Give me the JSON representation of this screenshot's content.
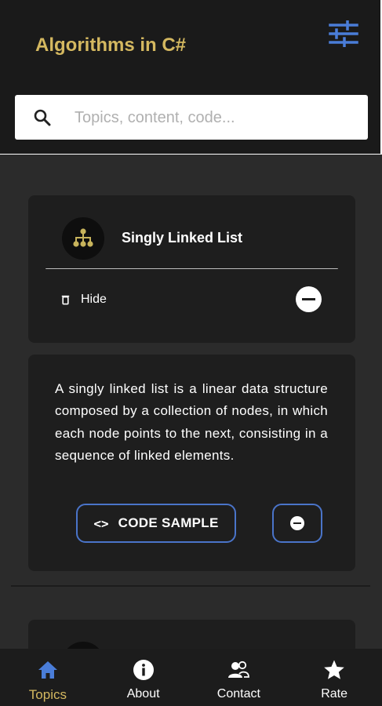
{
  "colors": {
    "accent": "#d4b860",
    "primary": "#4a74c9",
    "background": "#2b2b2b",
    "card": "#1e1e1e"
  },
  "header": {
    "title": "Algorithms in C#",
    "filter_icon": "sliders-icon",
    "search": {
      "placeholder": "Topics, content, code...",
      "value": "",
      "icon": "search-icon"
    }
  },
  "topic": {
    "title": "Singly Linked List",
    "icon": "tree-hierarchy-icon",
    "hide_label": "Hide",
    "hide_icon": "trash-icon",
    "collapse_icon": "minus-circle-icon"
  },
  "description": {
    "text": "A singly linked list is a linear data structure composed by a collection of nodes, in which each node points to the next, consisting in a sequence of linked elements.",
    "code_button_icon": "<>",
    "code_button_label": "CODE SAMPLE",
    "remove_icon": "minus-circle-icon"
  },
  "nav": {
    "items": [
      {
        "label": "Topics",
        "icon": "home-icon",
        "active": true
      },
      {
        "label": "About",
        "icon": "info-icon",
        "active": false
      },
      {
        "label": "Contact",
        "icon": "people-icon",
        "active": false
      },
      {
        "label": "Rate",
        "icon": "star-icon",
        "active": false
      }
    ]
  }
}
